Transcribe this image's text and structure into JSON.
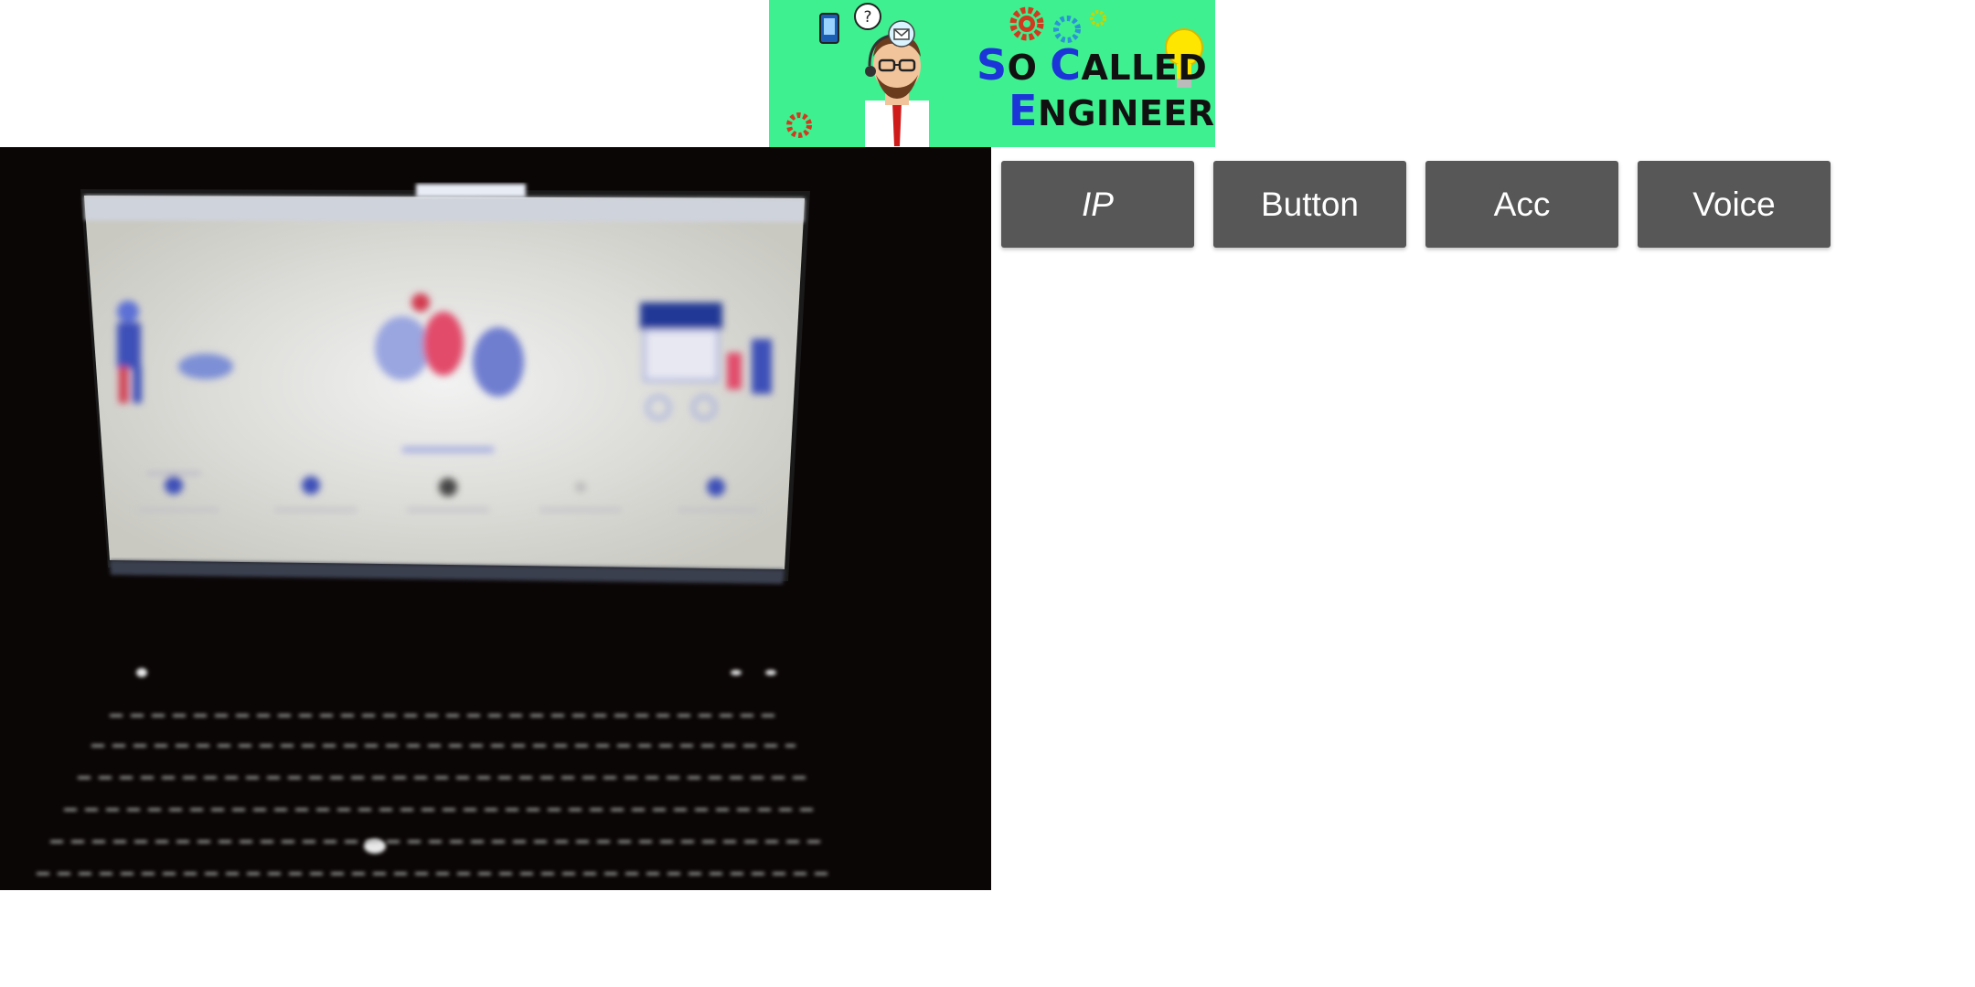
{
  "banner": {
    "line1_cap1": "S",
    "line1_rest1": "O ",
    "line1_cap2": "C",
    "line1_rest2": "ALLED",
    "line2_cap": "E",
    "line2_rest": "NGINEERS",
    "icons": [
      "engineer-mascot-icon",
      "gear-icon",
      "lightbulb-icon",
      "phone-icon",
      "question-bubble-icon",
      "envelope-icon"
    ]
  },
  "camera": {
    "feed": "laptop-screen-photo"
  },
  "buttons": [
    {
      "label": "IP",
      "italic": true
    },
    {
      "label": "Button",
      "italic": false
    },
    {
      "label": "Acc",
      "italic": false
    },
    {
      "label": "Voice",
      "italic": false
    }
  ],
  "colors": {
    "banner_bg": "#3ef08f",
    "button_bg": "#575757",
    "button_text": "#ffffff",
    "brand_blue": "#1b35d8"
  }
}
